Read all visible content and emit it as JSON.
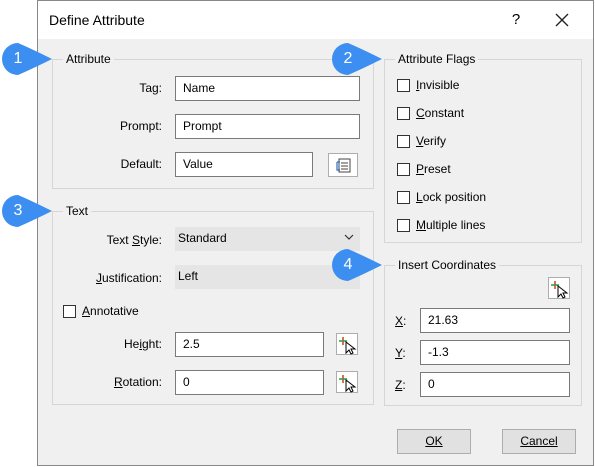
{
  "window": {
    "title": "Define Attribute",
    "help": "?"
  },
  "callouts": [
    "1",
    "2",
    "3",
    "4"
  ],
  "attribute": {
    "title": "Attribute",
    "tag_label": "Tag:",
    "tag_value": "Name",
    "prompt_label": "Prompt:",
    "prompt_value": "Prompt",
    "default_label": "Default:",
    "default_value": "Value"
  },
  "flags": {
    "title": "Attribute Flags",
    "items": [
      {
        "u": "I",
        "rest": "nvisible",
        "checked": false
      },
      {
        "u": "C",
        "rest": "onstant",
        "checked": false
      },
      {
        "u": "V",
        "rest": "erify",
        "checked": false
      },
      {
        "u": "P",
        "rest": "reset",
        "checked": false
      },
      {
        "u": "L",
        "rest": "ock position",
        "checked": false
      },
      {
        "u": "M",
        "rest": "ultiple lines",
        "checked": false
      }
    ]
  },
  "text": {
    "title": "Text",
    "style_label_pre": "Text ",
    "style_label_u": "S",
    "style_label_post": "tyle:",
    "style_value": "Standard",
    "just_label_u": "J",
    "just_label_post": "ustification:",
    "just_value": "Left",
    "annotative_u": "A",
    "annotative_post": "nnotative",
    "height_label_pre": "He",
    "height_label_u": "i",
    "height_label_post": "ght:",
    "height_value": "2.5",
    "rotation_label_u": "R",
    "rotation_label_post": "otation:",
    "rotation_value": "0"
  },
  "insert": {
    "title": "Insert Coordinates",
    "x_label": "X",
    "x_value": "21.63",
    "y_label": "Y",
    "y_value": "-1.3",
    "z_label": "Z",
    "z_value": "0"
  },
  "buttons": {
    "ok": "OK",
    "cancel": "Cancel"
  },
  "colors": {
    "callout": "#3c8ef0",
    "dialog_bg": "#f0f0f0",
    "pick_plus": "#d43a1f",
    "pick_plus2": "#2a9d3a"
  }
}
